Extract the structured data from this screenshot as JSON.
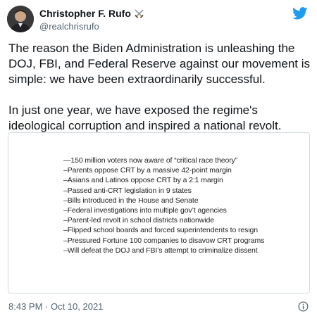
{
  "author": {
    "display_name": "Christopher F. Rufo",
    "handle": "@realchrisrufo",
    "name_badge_icon": "crossed-swords-icon",
    "avatar_icon": "avatar-photo"
  },
  "platform_icon": "twitter-bird-icon",
  "tweet": {
    "paragraphs": [
      "The reason the Biden Administration is unleashing the DOJ, FBI, and Federal Reserve against our movement is simple: we have been extraordinarily successful.",
      "In just one year, we have exposed the regime's ideological corruption and inspired a national revolt."
    ]
  },
  "media": {
    "lines": [
      "—150 million voters now aware of “critical race theory”",
      "–Parents oppose CRT by a massive 42-point margin",
      "–Asians and Latinos oppose CRT by a 2:1 margin",
      "–Passed anti-CRT legislation in 9 states",
      "–Bills introduced in the House and Senate",
      "–Federal investigations into multiple gov’t agencies",
      "–Parent-led revolt in school districts nationwide",
      "–Flipped school boards and forced superintendents to resign",
      "–Pressured Fortune 100 companies to disavow CRT programs",
      "–Will defeat the DOJ and FBI’s attempt to criminalize dissent"
    ]
  },
  "footer": {
    "timestamp": "8:43 PM · Oct 10, 2021",
    "info_icon": "info-icon"
  },
  "colors": {
    "twitter_blue": "#1d9bf0",
    "text_primary": "#0f1419",
    "text_secondary": "#536471",
    "border": "#cfd9de"
  }
}
